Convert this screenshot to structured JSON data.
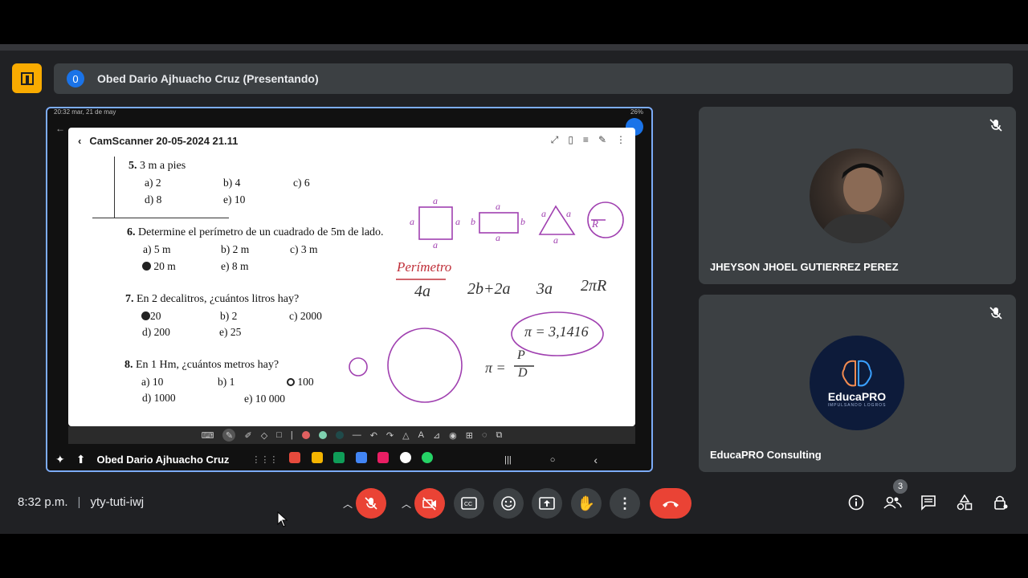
{
  "meeting": {
    "presenter_banner": "Obed Dario Ajhuacho Cruz (Presentando)",
    "presenter_count": "0",
    "time": "8:32 p.m.",
    "code": "yty-tuti-iwj",
    "people_count": "3"
  },
  "tablet": {
    "status_left": "20:32  mar, 21 de may",
    "status_right": "26%",
    "doc_title": "CamScanner 20-05-2024 21.11",
    "nav_name": "Obed Dario Ajhuacho Cruz"
  },
  "worksheet": {
    "q5": {
      "num": "5.",
      "text": "3 m  a  pies",
      "a": "a) 2",
      "b": "b) 4",
      "c": "c) 6",
      "d": "d) 8",
      "e": "e) 10"
    },
    "q6": {
      "num": "6.",
      "text": "Determine el perímetro de un cuadrado de 5m de lado.",
      "a": "a) 5 m",
      "b": "b) 2 m",
      "c": "c) 3 m",
      "d": "20 m",
      "e": "e) 8 m"
    },
    "q7": {
      "num": "7.",
      "text": "En 2 decalitros, ¿cuántos litros hay?",
      "a": "20",
      "b": "b) 2",
      "c": "c) 2000",
      "d": "d) 200",
      "e": "e) 25"
    },
    "q8": {
      "num": "8.",
      "text": "En 1 Hm, ¿cuántos metros hay?",
      "a": "a) 10",
      "b": "b) 1",
      "c": "100",
      "d": "d) 1000",
      "e": "e) 10 000"
    }
  },
  "handwriting": {
    "perimetro": "Perímetro",
    "f1": "4a",
    "f2": "2b+2a",
    "f3": "3a",
    "f4": "2πR",
    "pi_value": "π = 3,1416",
    "pi_formula_left": "π =",
    "pi_num": "P",
    "pi_den": "D",
    "r_label": "R",
    "a": "a",
    "b": "b"
  },
  "participants": [
    {
      "name": "JHEYSON JHOEL GUTIERREZ PEREZ"
    },
    {
      "name": "EducaPRO Consulting",
      "logo_text": "EducaPRO",
      "logo_sub": "IMPULSANDO LOGROS"
    }
  ],
  "colors": {
    "accent": "#1a73e8",
    "danger": "#ea4335",
    "logo_yellow": "#f9ab00",
    "ink_purple": "#a040b0"
  }
}
